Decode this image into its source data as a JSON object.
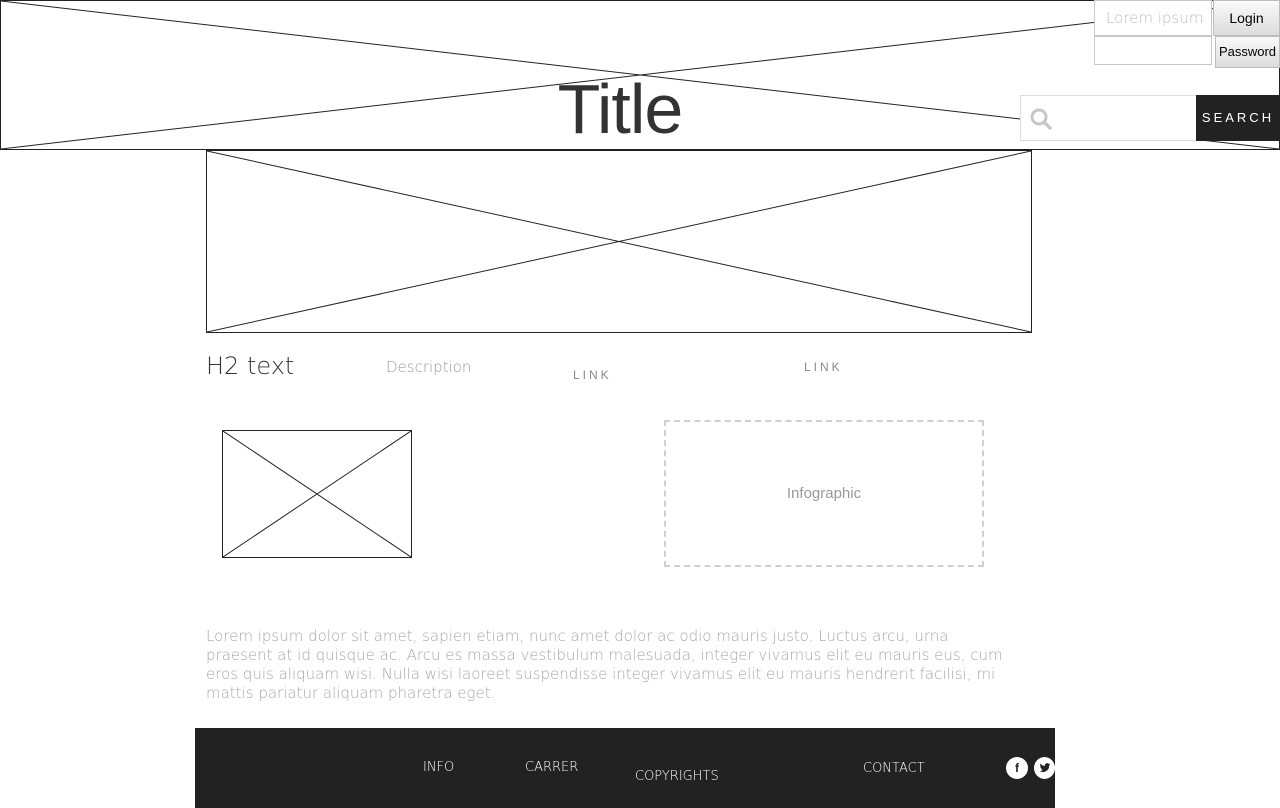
{
  "header": {
    "title": "Title",
    "login": {
      "username_placeholder": "Lorem ipsum",
      "login_label": "Login",
      "password_label": "Password"
    },
    "search": {
      "icon": "search-icon",
      "button_label": "SEARCH"
    }
  },
  "content": {
    "h2": "H2 text",
    "description": "Description",
    "link_1": "LINK",
    "link_2": "LINK",
    "infographic": "Infographic",
    "paragraph": "Lorem ipsum dolor sit amet, sapien etiam, nunc amet dolor ac odio mauris justo. Luctus arcu, urna praesent at id quisque ac. Arcu es massa vestibulum malesuada, integer vivamus elit eu mauris eus, cum eros quis aliquam wisi. Nulla wisi laoreet suspendisse integer vivamus elit eu mauris hendrerit facilisi, mi mattis pariatur aliquam pharetra eget."
  },
  "footer": {
    "info": "INFO",
    "carrer": "CARRER",
    "copyrights": "COPYRIGHTS",
    "contact": "CONTACT",
    "social": [
      {
        "icon": "facebook-icon",
        "glyph": "f"
      },
      {
        "icon": "twitter-icon",
        "glyph": "t"
      }
    ]
  },
  "colors": {
    "dark": "#222222",
    "muted_text": "#a8a8a8",
    "title_text": "#333333"
  }
}
